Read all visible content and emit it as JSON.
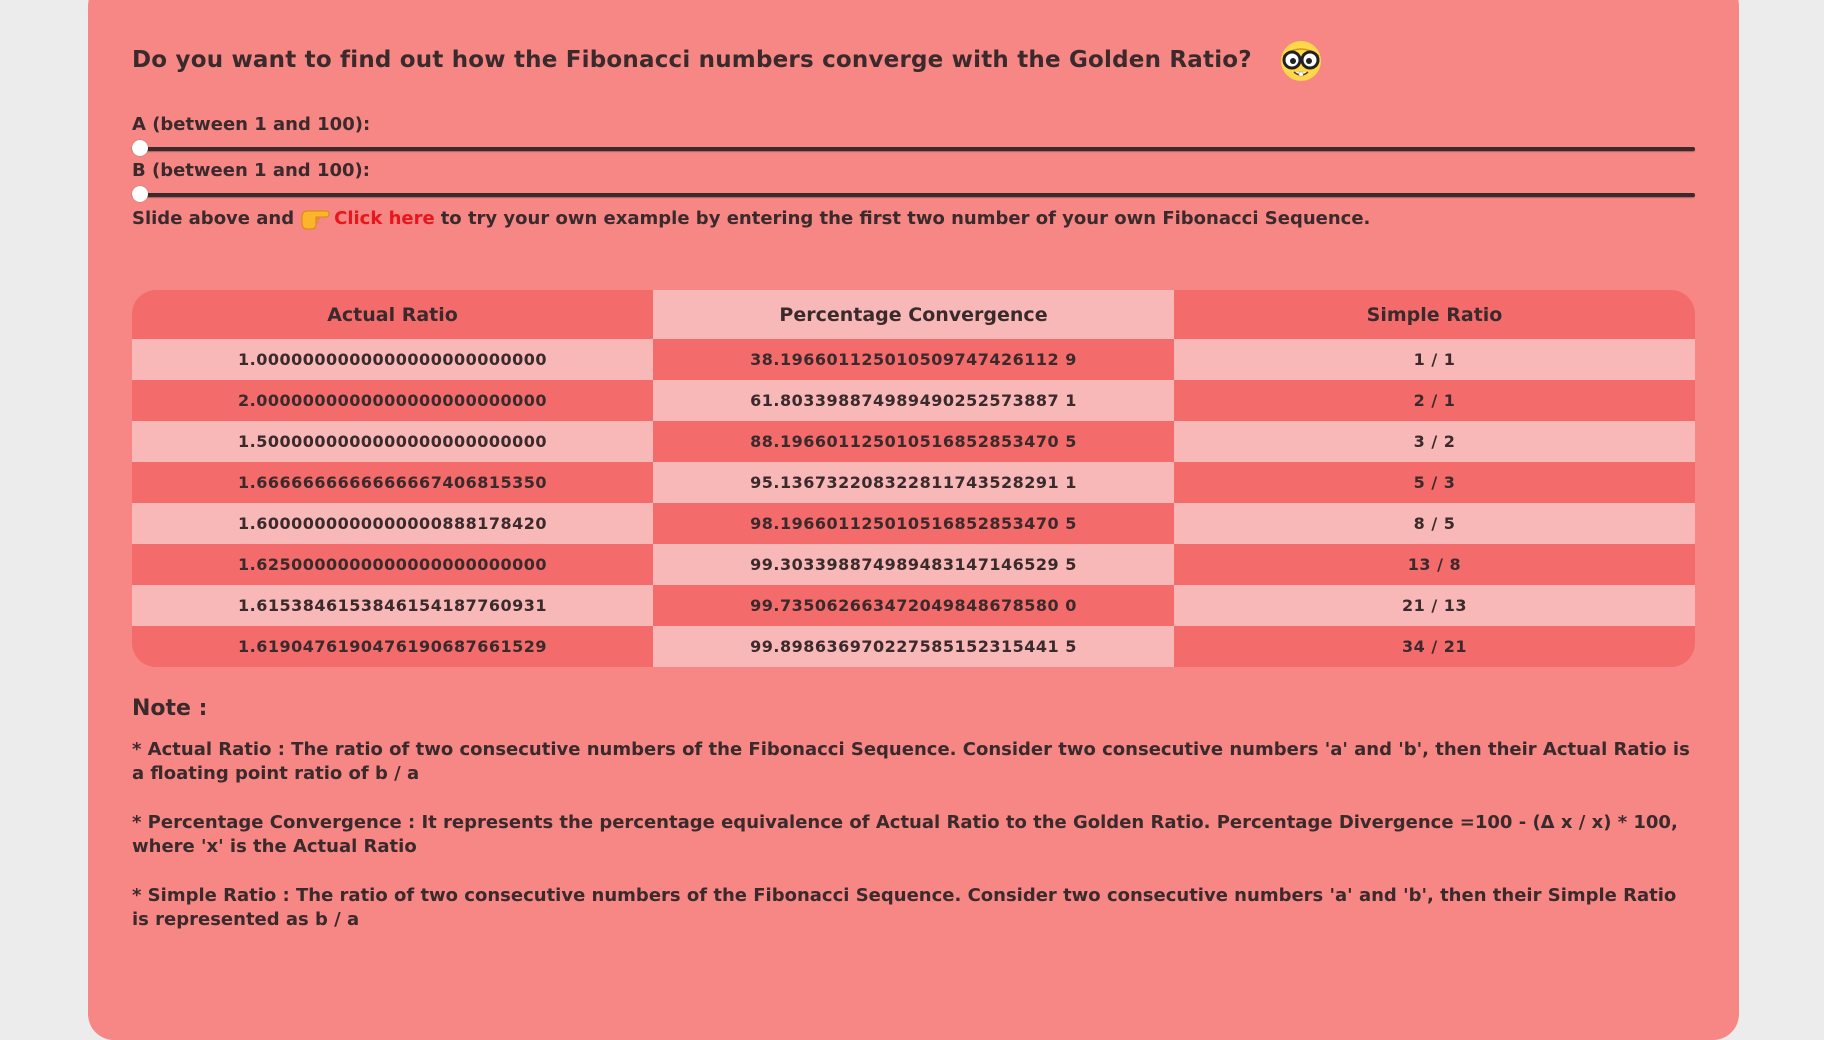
{
  "heading": "Do you want to find out how the Fibonacci numbers converge with the Golden Ratio?",
  "heading_icon": "nerd-face-icon",
  "slider_a": {
    "label": "A (between 1 and 100):",
    "value": 1,
    "min": 1,
    "max": 100
  },
  "slider_b": {
    "label": "B (between 1 and 100):",
    "value": 1,
    "min": 1,
    "max": 100
  },
  "instruction": {
    "prefix": "Slide above and",
    "icon": "pointing-hand-icon",
    "link": "Click here",
    "suffix": "to try your own example by entering the first two number of your own Fibonacci Sequence."
  },
  "table": {
    "headers": [
      "Actual Ratio",
      "Percentage Convergence",
      "Simple Ratio"
    ],
    "rows": [
      [
        "1.0000000000000000000000000",
        "38.196601125010509747426112 9",
        "1 / 1"
      ],
      [
        "2.0000000000000000000000000",
        "61.803398874989490252573887 1",
        "2 / 1"
      ],
      [
        "1.5000000000000000000000000",
        "88.196601125010516852853470 5",
        "3 / 2"
      ],
      [
        "1.6666666666666667406815350",
        "95.136732208322811743528291 1",
        "5 / 3"
      ],
      [
        "1.6000000000000000888178420",
        "98.196601125010516852853470 5",
        "8 / 5"
      ],
      [
        "1.6250000000000000000000000",
        "99.303398874989483147146529 5",
        "13 / 8"
      ],
      [
        "1.6153846153846154187760931",
        "99.735062663472049848678580 0",
        "21 / 13"
      ],
      [
        "1.6190476190476190687661529",
        "99.898636970227585152315441 5",
        "34 / 21"
      ]
    ]
  },
  "note": {
    "title": "Note :",
    "items": [
      "* Actual Ratio : The ratio of two consecutive numbers of the Fibonacci Sequence. Consider two consecutive numbers 'a' and 'b', then their Actual Ratio is a floating point ratio of b / a",
      "* Percentage Convergence : It represents the percentage equivalence of Actual Ratio to the Golden Ratio. Percentage Divergence =100 - (Δ x / x) * 100, where 'x' is the Actual Ratio",
      "* Simple Ratio : The ratio of two consecutive numbers of the Fibonacci Sequence. Consider two consecutive numbers 'a' and 'b', then their Simple Ratio is represented as b / a"
    ]
  },
  "colors": {
    "card": "#f78785",
    "row_dark": "#f46b6c",
    "row_light": "#f9b8b8",
    "link": "#e8161d"
  }
}
